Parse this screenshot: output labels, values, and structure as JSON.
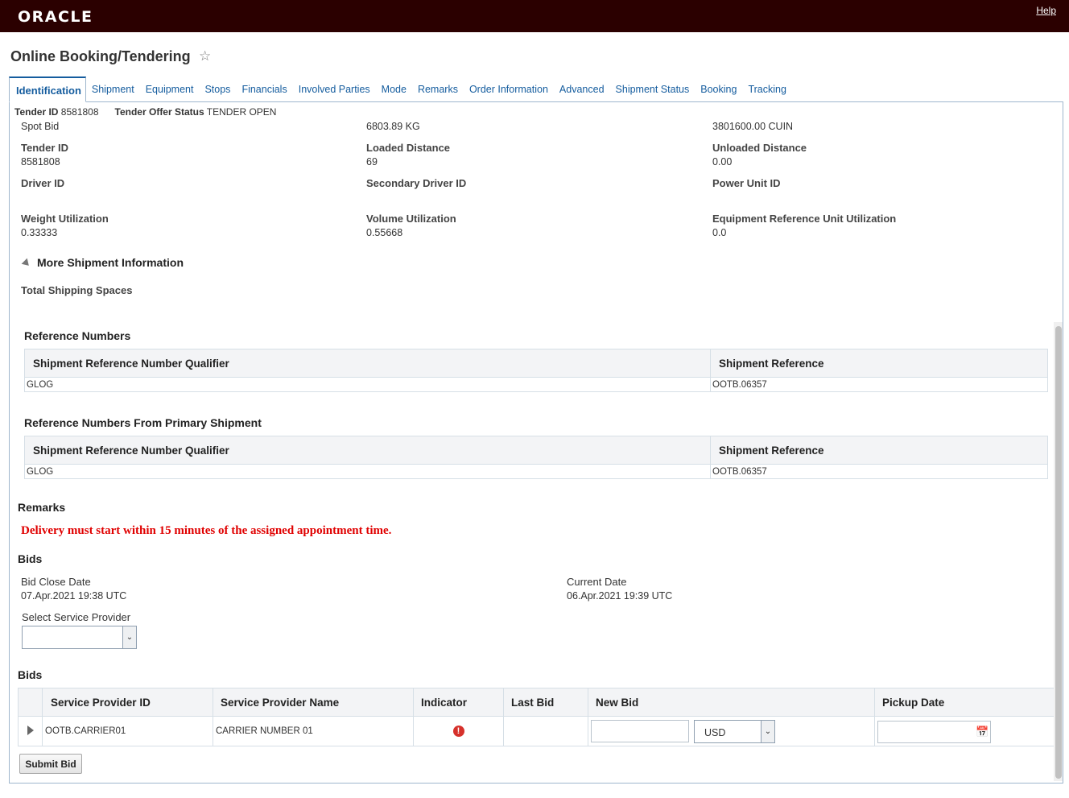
{
  "header": {
    "brand": "ORACLE",
    "help": "Help"
  },
  "page_title": "Online Booking/Tendering",
  "tabs": [
    "Identification",
    "Shipment",
    "Equipment",
    "Stops",
    "Financials",
    "Involved Parties",
    "Mode",
    "Remarks",
    "Order Information",
    "Advanced",
    "Shipment Status",
    "Booking",
    "Tracking"
  ],
  "tender_line": {
    "tender_id_label": "Tender ID",
    "tender_id": "8581808",
    "status_label": "Tender Offer Status",
    "status": "TENDER OPEN"
  },
  "top_row": {
    "c1": "Spot Bid",
    "c2": "6803.89 KG",
    "c3": "3801600.00 CUIN"
  },
  "fields": {
    "tender_id": {
      "label": "Tender ID",
      "value": "8581808"
    },
    "loaded_distance": {
      "label": "Loaded Distance",
      "value": "69"
    },
    "unloaded_distance": {
      "label": "Unloaded Distance",
      "value": "0.00"
    },
    "driver_id": {
      "label": "Driver ID",
      "value": ""
    },
    "secondary_driver_id": {
      "label": "Secondary Driver ID",
      "value": ""
    },
    "power_unit_id": {
      "label": "Power Unit ID",
      "value": ""
    },
    "weight_utilization": {
      "label": "Weight Utilization",
      "value": "0.33333"
    },
    "volume_utilization": {
      "label": "Volume Utilization",
      "value": "0.55668"
    },
    "equipment_ref_utilization": {
      "label": "Equipment Reference Unit Utilization",
      "value": "0.0"
    }
  },
  "more_info": {
    "title": "More Shipment Information",
    "total_spaces_label": "Total Shipping Spaces"
  },
  "ref_numbers": {
    "title": "Reference Numbers",
    "columns": [
      "Shipment Reference Number Qualifier",
      "Shipment Reference"
    ],
    "rows": [
      [
        "GLOG",
        "OOTB.06357"
      ]
    ]
  },
  "ref_numbers_primary": {
    "title": "Reference Numbers From Primary Shipment",
    "columns": [
      "Shipment Reference Number Qualifier",
      "Shipment Reference"
    ],
    "rows": [
      [
        "GLOG",
        "OOTB.06357"
      ]
    ]
  },
  "remarks": {
    "title": "Remarks",
    "text": "Delivery must start within 15 minutes of the assigned appointment time."
  },
  "bids_info": {
    "title": "Bids",
    "bid_close_label": "Bid Close Date",
    "bid_close_value": "07.Apr.2021 19:38 UTC",
    "current_date_label": "Current Date",
    "current_date_value": "06.Apr.2021 19:39 UTC",
    "service_provider_label": "Select Service Provider",
    "service_provider_value": ""
  },
  "bids_table": {
    "title": "Bids",
    "columns": [
      "Service Provider ID",
      "Service Provider Name",
      "Indicator",
      "Last Bid",
      "New Bid",
      "Pickup Date"
    ],
    "row": {
      "provider_id": "OOTB.CARRIER01",
      "provider_name": "CARRIER NUMBER 01",
      "last_bid": "",
      "new_bid": "",
      "currency": "USD",
      "pickup_date": ""
    }
  },
  "submit_label": "Submit Bid",
  "colors": {
    "topbar": "#2b0000",
    "link": "#145c9e",
    "alert": "#e00000",
    "error_icon": "#d6312b"
  }
}
